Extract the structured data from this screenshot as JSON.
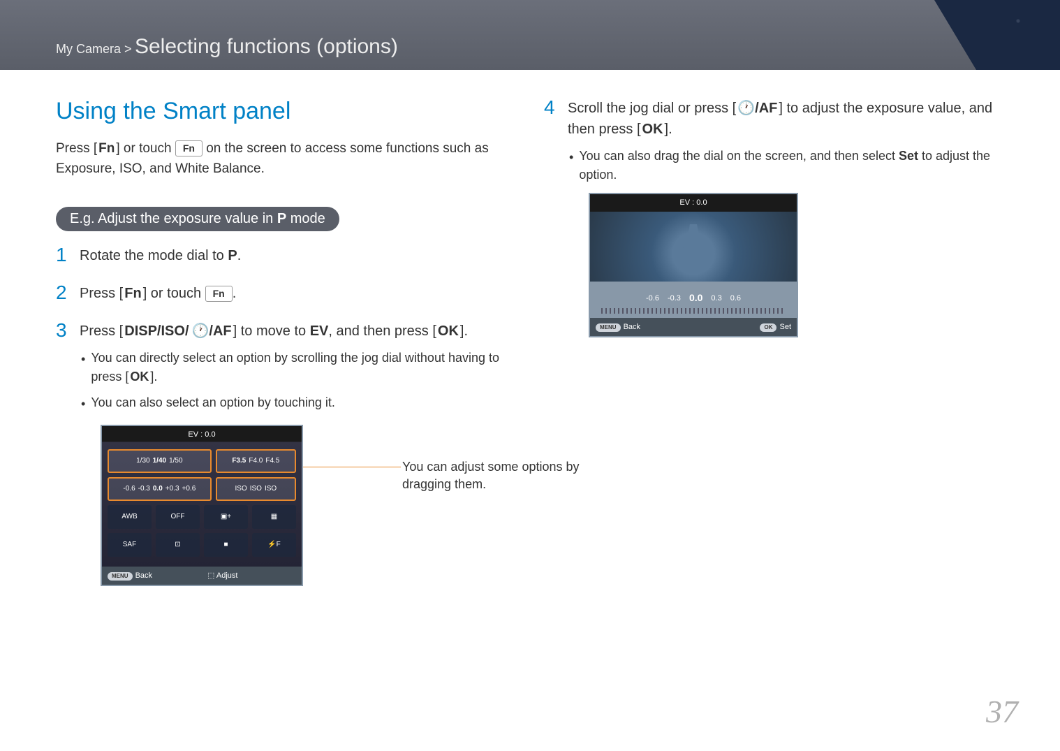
{
  "breadcrumb": {
    "prefix": "My Camera >",
    "title": "Selecting functions (options)"
  },
  "section_title": "Using the Smart panel",
  "intro_p1": "Press [",
  "intro_fn": "Fn",
  "intro_p2": "] or touch ",
  "intro_btn": "Fn",
  "intro_p3": " on the screen to access some functions such as Exposure, ISO, and White Balance.",
  "example_label_pre": "E.g. Adjust the exposure value in ",
  "example_label_mode": "P",
  "example_label_post": " mode",
  "steps_left": [
    {
      "n": "1",
      "pre": "Rotate the mode dial to ",
      "key": "P",
      "post": "."
    },
    {
      "n": "2",
      "pre": "Press [",
      "key": "Fn",
      "post": "] or touch ",
      "btn": "Fn",
      "tail": "."
    },
    {
      "n": "3",
      "pre": "Press [",
      "keys": "DISP/ISO/",
      "icons": "🕐/AF",
      "mid": "] to move to ",
      "bold": "EV",
      "post": ", and then press [",
      "ok": "OK",
      "tail": "]."
    }
  ],
  "bullets_left": [
    {
      "pre": "You can directly select an option by scrolling the jog dial without having to press [",
      "ok": "OK",
      "post": "]."
    },
    {
      "text": "You can also select an option by touching it."
    }
  ],
  "screenshot1": {
    "title": "EV : 0.0",
    "row1a": {
      "vals": [
        "1/30",
        "1/40",
        "1/50"
      ]
    },
    "row1b": {
      "vals": [
        "F3.5",
        "F4.0",
        "F4.5"
      ]
    },
    "row2a": {
      "vals": [
        "-0.6",
        "-0.3",
        "0.0",
        "+0.3",
        "+0.6"
      ]
    },
    "row2b": {
      "vals": [
        "ISO",
        "ISO",
        "ISO"
      ]
    },
    "row3": [
      "AWB",
      "OFF",
      "▣+",
      "▦"
    ],
    "row4": [
      "SAF",
      "⊡",
      "■",
      "⚡F"
    ],
    "foot_left_chip": "MENU",
    "foot_left": "Back",
    "foot_right_icon": "⬚",
    "foot_right": "Adjust"
  },
  "callout": "You can adjust some options by dragging them.",
  "step4": {
    "n": "4",
    "pre": "Scroll the jog dial or press [",
    "icons": "🕐/AF",
    "mid": "] to adjust the exposure value, and then press [",
    "ok": "OK",
    "post": "]."
  },
  "bullet_right": {
    "pre": "You can also drag the dial on the screen, and then select ",
    "bold": "Set",
    "post": " to adjust the option."
  },
  "screenshot2": {
    "title": "EV : 0.0",
    "vals": [
      "-0.6",
      "-0.3",
      "0.0",
      "0.3",
      "0.6"
    ],
    "foot_left_chip": "MENU",
    "foot_left": "Back",
    "foot_right_chip": "OK",
    "foot_right": "Set"
  },
  "page_number": "37"
}
